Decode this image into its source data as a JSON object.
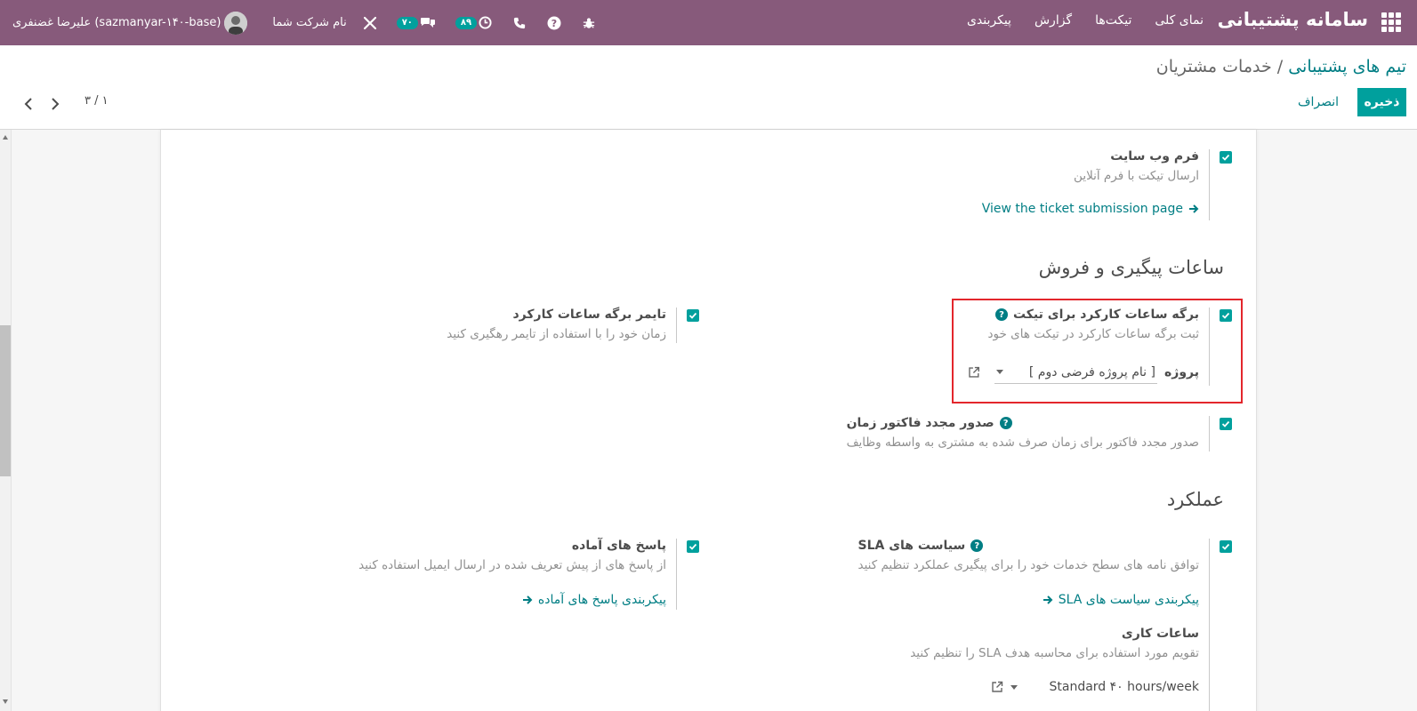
{
  "navbar": {
    "app_title": "سامانه پشتیبانی",
    "menu": [
      "نمای کلی",
      "تیکت‌ها",
      "گزارش",
      "پیکربندی"
    ],
    "company": "نام شرکت شما",
    "user": "علیرضا غضنفری (sazmanyar-۱۴۰-base)",
    "activity_count": "۸۹",
    "messages_count": "۷۰"
  },
  "breadcrumb": {
    "parent": "تیم های پشتیبانی",
    "separator": " / ",
    "current": "خدمات مشتریان"
  },
  "actions": {
    "save": "ذخیره",
    "discard": "انصراف"
  },
  "pager": {
    "value": "۳ / ۱"
  },
  "website_form": {
    "title": "فرم وب سایت",
    "desc": "ارسال تیکت با فرم آنلاین",
    "link": "View the ticket submission page",
    "checked": true
  },
  "sections": {
    "timesheet_sales": "ساعات پیگیری و فروش",
    "performance": "عملکرد"
  },
  "timesheet": {
    "title": "برگه ساعات کارکرد برای تیکت",
    "desc": "ثبت برگه ساعات کارکرد در تیکت های خود",
    "project_label": "پروژه",
    "project_value": "[ نام پروژه فرضی دوم ]",
    "checked": true
  },
  "timer": {
    "title": "تایمر برگه ساعات کارکرد",
    "desc": "زمان خود را با استفاده از تایمر رهگیری کنید",
    "checked": true
  },
  "reinvoice": {
    "title": "صدور مجدد فاکتور زمان",
    "desc": "صدور مجدد فاکتور برای زمان صرف شده به مشتری به واسطه وظایف",
    "checked": true
  },
  "sla": {
    "title": "سیاست های SLA",
    "desc": "توافق نامه های سطح خدمات خود را برای پیگیری عملکرد تنظیم کنید",
    "link": "پیکربندی سیاست های SLA",
    "working_hours_title": "ساعات کاری",
    "working_hours_desc": "تقویم مورد استفاده برای محاسبه هدف SLA را تنظیم کنید",
    "working_hours_value": "Standard ۴۰ hours/week",
    "checked": true
  },
  "canned": {
    "title": "پاسخ های آماده",
    "desc": "از پاسخ های از پیش تعریف شده در ارسال ایمیل استفاده کنید",
    "link": "پیکربندی پاسخ های آماده",
    "checked": true
  },
  "colors": {
    "navbar": "#875a7b",
    "primary": "#00a09d",
    "link": "#017e84",
    "highlight": "#e3262c"
  }
}
